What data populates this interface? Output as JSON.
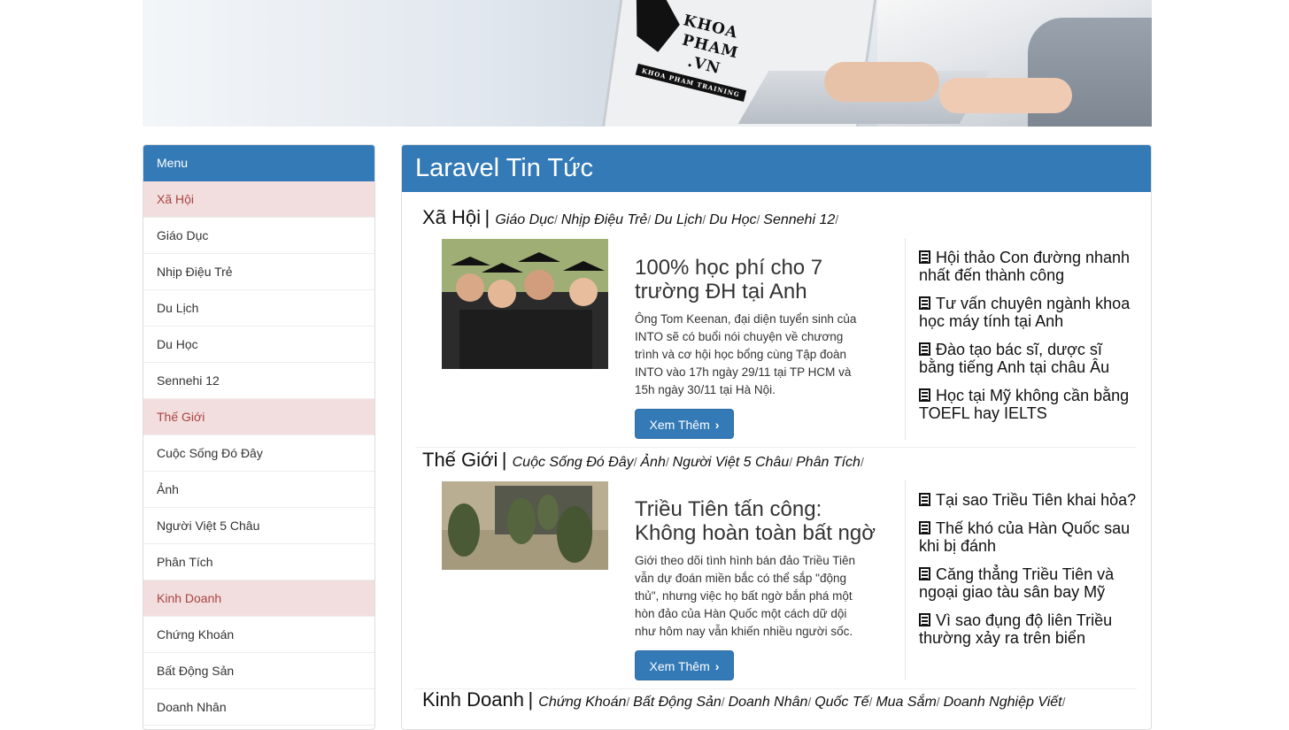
{
  "banner": {
    "logo_line1": "KHOA",
    "logo_line2": "PHAM",
    "logo_line3": ".VN",
    "logo_tag": "KHOA PHAM TRAINING"
  },
  "menu": {
    "title": "Menu",
    "items": [
      {
        "label": "Xã Hội",
        "type": "category"
      },
      {
        "label": "Giáo Dục",
        "type": "link"
      },
      {
        "label": "Nhịp Điệu Trẻ",
        "type": "link"
      },
      {
        "label": "Du Lịch",
        "type": "link"
      },
      {
        "label": "Du Học",
        "type": "link"
      },
      {
        "label": "Sennehi 12",
        "type": "link"
      },
      {
        "label": "Thế Giới",
        "type": "category"
      },
      {
        "label": "Cuộc Sống Đó Đây",
        "type": "link"
      },
      {
        "label": "Ảnh",
        "type": "link"
      },
      {
        "label": "Người Việt 5 Châu",
        "type": "link"
      },
      {
        "label": "Phân Tích",
        "type": "link"
      },
      {
        "label": "Kinh Doanh",
        "type": "category"
      },
      {
        "label": "Chứng Khoán",
        "type": "link"
      },
      {
        "label": "Bất Động Sản",
        "type": "link"
      },
      {
        "label": "Doanh Nhân",
        "type": "link"
      }
    ]
  },
  "main": {
    "title": "Laravel Tin Tức",
    "button_label": "Xem Thêm",
    "sections": [
      {
        "name": "Xã Hội",
        "subs": [
          "Giáo Dục",
          "Nhịp Điệu Trẻ",
          "Du Lịch",
          "Du Học",
          "Sennehi 12"
        ],
        "article_title": "100% học phí cho 7 trường ĐH tại Anh",
        "article_desc": "Ông Tom Keenan, đại diện tuyển sinh của INTO sẽ có buổi nói chuyện về chương trình và cơ hội học bổng cùng Tập đoàn INTO vào 17h ngày 29/11 tại TP HCM và 15h ngày 30/11 tại Hà Nội.",
        "related": [
          "Hội thảo Con đường nhanh nhất đến thành công",
          "Tư vấn chuyên ngành khoa học máy tính tại Anh",
          "Đào tạo bác sĩ, dược sĩ bằng tiếng Anh tại châu Âu",
          "Học tại Mỹ không cần bằng TOEFL hay IELTS"
        ]
      },
      {
        "name": "Thế Giới",
        "subs": [
          "Cuộc Sống Đó Đây",
          "Ảnh",
          "Người Việt 5 Châu",
          "Phân Tích"
        ],
        "article_title": "Triều Tiên tấn công: Không hoàn toàn bất ngờ",
        "article_desc": "Giới theo dõi tình hình bán đảo Triều Tiên vẫn dự đoán miền bắc có thể sắp \"động thủ\", nhưng việc họ bất ngờ bắn phá một hòn đảo của Hàn Quốc một cách dữ dội như hôm nay vẫn khiến nhiều người sốc.",
        "related": [
          "Tại sao Triều Tiên khai hỏa?",
          "Thế khó của Hàn Quốc sau khi bị đánh",
          "Căng thẳng Triều Tiên và ngoại giao tàu sân bay Mỹ",
          "Vì sao đụng độ liên Triều thường xảy ra trên biển"
        ]
      },
      {
        "name": "Kinh Doanh",
        "subs": [
          "Chứng Khoán",
          "Bất Động Sản",
          "Doanh Nhân",
          "Quốc Tế",
          "Mua Sắm",
          "Doanh Nghiệp Viết"
        ]
      }
    ]
  }
}
